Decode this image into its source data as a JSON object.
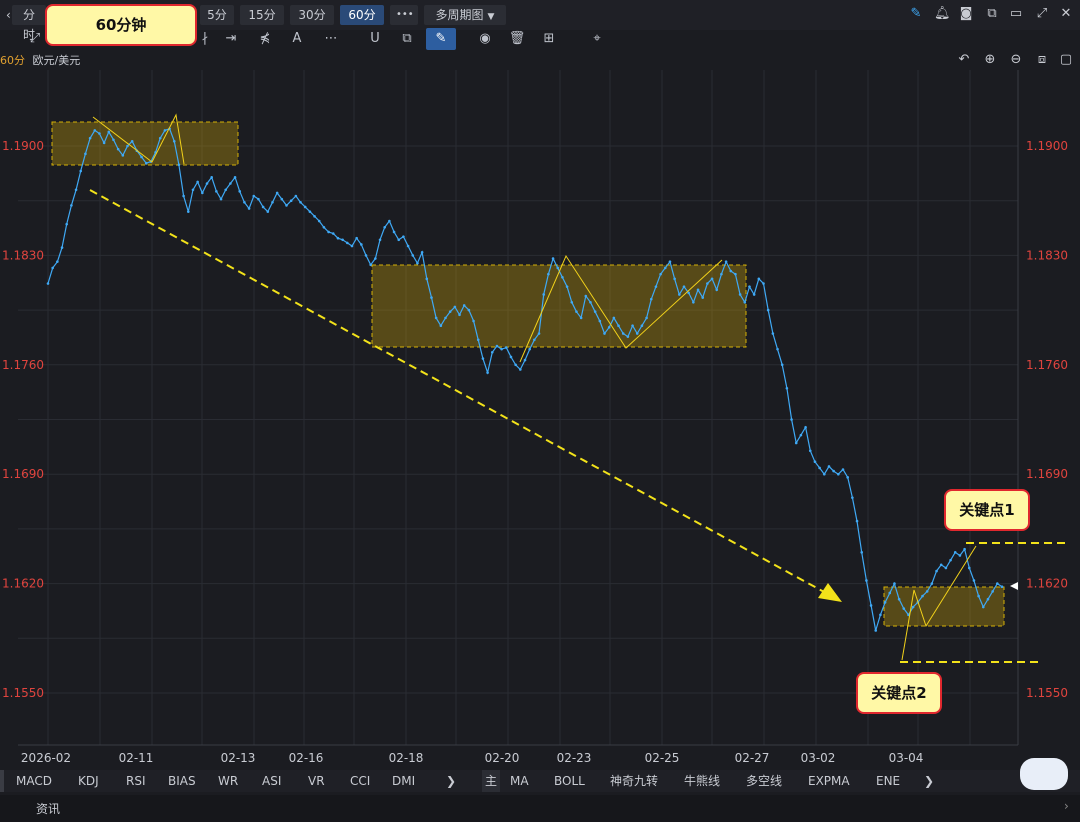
{
  "toolbar": {
    "back_glyph": "‹",
    "intervals": [
      {
        "label": "分时",
        "active": false
      },
      {
        "label": "5分",
        "active": false
      },
      {
        "label": "15分",
        "active": false
      },
      {
        "label": "30分",
        "active": false
      },
      {
        "label": "60分",
        "active": true
      }
    ],
    "more_label": "•••",
    "multi_period_label": "多周期图",
    "callout_period": "60分钟"
  },
  "drawing_tools": [
    "⤢",
    "∤",
    "⇥",
    "⋠",
    "A",
    "⋯",
    "U",
    "⧉",
    "✎",
    "◉",
    "🗑",
    "⊞",
    "⌖"
  ],
  "chart_label": {
    "period": "60分",
    "symbol": "欧元/美元"
  },
  "bottom_indicators_left": [
    "MACD",
    "KDJ",
    "RSI",
    "BIAS",
    "WR",
    "ASI",
    "VR",
    "CCI",
    "DMI"
  ],
  "bottom_indicators_right_main": "主",
  "bottom_indicators_right": [
    "MA",
    "BOLL",
    "神奇九转",
    "牛熊线",
    "多空线",
    "EXPMA",
    "ENE"
  ],
  "footer_tab": "资讯",
  "annotations": {
    "key_point_1": "关键点1",
    "key_point_2": "关键点2"
  },
  "colors": {
    "price_line": "#3fa9f5",
    "axis_label": "#e0443e",
    "zone": "#d4b106",
    "trend_arrow": "#f2e21a"
  },
  "chart_data": {
    "type": "line",
    "title": "",
    "series_name": "欧元/美元",
    "ylim": [
      1.153,
      1.195
    ],
    "y_ticks": [
      "1.1900",
      "1.1830",
      "1.1760",
      "1.1690",
      "1.1620",
      "1.1550"
    ],
    "x_ticks": [
      "2026-02",
      "02-11",
      "02-13",
      "02-16",
      "02-18",
      "02-20",
      "02-23",
      "02-25",
      "02-27",
      "03-02",
      "03-04"
    ],
    "values": [
      1.1812,
      1.1822,
      1.1826,
      1.1835,
      1.185,
      1.1862,
      1.1872,
      1.1884,
      1.1895,
      1.1905,
      1.191,
      1.1908,
      1.1902,
      1.1909,
      1.1904,
      1.1898,
      1.1894,
      1.19,
      1.1903,
      1.1897,
      1.1893,
      1.1889,
      1.189,
      1.1896,
      1.1905,
      1.191,
      1.1911,
      1.1903,
      1.1888,
      1.1868,
      1.1858,
      1.1872,
      1.1877,
      1.187,
      1.1876,
      1.188,
      1.1871,
      1.1866,
      1.1872,
      1.1876,
      1.188,
      1.1871,
      1.1864,
      1.186,
      1.1868,
      1.1866,
      1.1861,
      1.1858,
      1.1864,
      1.187,
      1.1866,
      1.1862,
      1.1865,
      1.1868,
      1.1864,
      1.1861,
      1.1858,
      1.1855,
      1.1852,
      1.1848,
      1.1845,
      1.1844,
      1.1841,
      1.184,
      1.1838,
      1.1836,
      1.1841,
      1.1837,
      1.183,
      1.1824,
      1.1828,
      1.184,
      1.1848,
      1.1852,
      1.1845,
      1.184,
      1.1842,
      1.1836,
      1.183,
      1.1825,
      1.1832,
      1.1815,
      1.1803,
      1.179,
      1.1785,
      1.179,
      1.1794,
      1.1797,
      1.1792,
      1.1798,
      1.1795,
      1.1788,
      1.1776,
      1.1764,
      1.1755,
      1.1768,
      1.1772,
      1.177,
      1.1771,
      1.1765,
      1.176,
      1.1757,
      1.1763,
      1.177,
      1.1776,
      1.178,
      1.1805,
      1.1818,
      1.1828,
      1.1822,
      1.1816,
      1.181,
      1.18,
      1.1794,
      1.179,
      1.1804,
      1.18,
      1.1794,
      1.1788,
      1.178,
      1.1784,
      1.179,
      1.1785,
      1.178,
      1.1778,
      1.1785,
      1.178,
      1.1785,
      1.179,
      1.1802,
      1.181,
      1.1818,
      1.1822,
      1.1826,
      1.1815,
      1.1805,
      1.181,
      1.1806,
      1.18,
      1.1808,
      1.1803,
      1.1812,
      1.1815,
      1.1808,
      1.1818,
      1.1826,
      1.182,
      1.1818,
      1.1805,
      1.18,
      1.181,
      1.1805,
      1.1815,
      1.1812,
      1.1795,
      1.178,
      1.177,
      1.176,
      1.1745,
      1.1725,
      1.171,
      1.1715,
      1.172,
      1.1705,
      1.1698,
      1.1694,
      1.169,
      1.1695,
      1.1692,
      1.169,
      1.1693,
      1.1688,
      1.1675,
      1.166,
      1.164,
      1.1622,
      1.1606,
      1.159,
      1.16,
      1.1608,
      1.1614,
      1.162,
      1.161,
      1.1604,
      1.16,
      1.1605,
      1.1608,
      1.1612,
      1.1615,
      1.162,
      1.1628,
      1.1632,
      1.163,
      1.1635,
      1.164,
      1.1638,
      1.1642,
      1.163,
      1.1622,
      1.1612,
      1.1605,
      1.161,
      1.1615,
      1.162,
      1.1618
    ]
  }
}
